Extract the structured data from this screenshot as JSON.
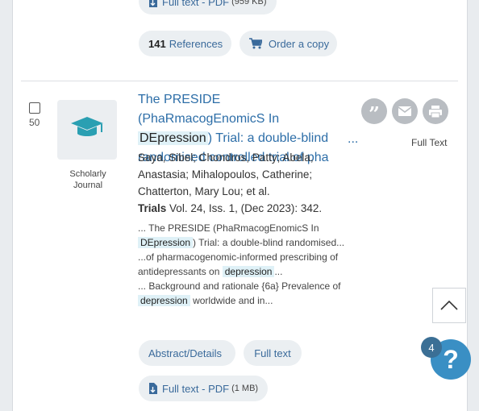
{
  "top_result": {
    "fulltext_pdf_label": "Full text - PDF",
    "fulltext_pdf_size": "(959 KB)",
    "references_count": "141",
    "references_label": "References",
    "order_copy_label": "Order a copy"
  },
  "result": {
    "number": "50",
    "type_label_line1": "Scholarly",
    "type_label_line2": "Journal",
    "title_part1": "The PRESIDE (PhaRmacogEnomicS In",
    "title_highlight": "DEpression",
    "title_part2": ") Trial: a double-blind randomised controlled trial of pha",
    "title_more": "...",
    "authors": "Saya, Sibel; Chondros, Patty; Abela, Anastasia; Mihalopoulos, Catherine; Chatterton, Mary Lou; et al.",
    "journal_name": "Trials",
    "journal_details": "Vol. 24, Iss. 1,  (Dec 2023): 342.",
    "snippet1_pre": "... The PRESIDE (PhaRmacogEnomicS In",
    "snippet1_hl": "DEpression",
    "snippet1_post": ") Trial: a double-blind randomised...",
    "snippet2_pre": "...of pharmacogenomic-informed prescribing of antidepressants on",
    "snippet2_hl": "depression",
    "snippet2_post": "...",
    "snippet3_pre": "... Background and rationale {6a} Prevalence of",
    "snippet3_hl": "depression",
    "snippet3_post": "worldwide and in...",
    "abstract_label": "Abstract/Details",
    "fulltext_label": "Full text",
    "fulltext_pdf_label": "Full text - PDF",
    "fulltext_pdf_size": "(1 MB)",
    "full_text_caption": "Full Text"
  },
  "help": {
    "badge_count": "4",
    "icon": "?"
  },
  "colors": {
    "link": "#3a6a9b",
    "title": "#2d6ea8",
    "highlight": "#dff1f7",
    "help": "#3a8fc4"
  }
}
